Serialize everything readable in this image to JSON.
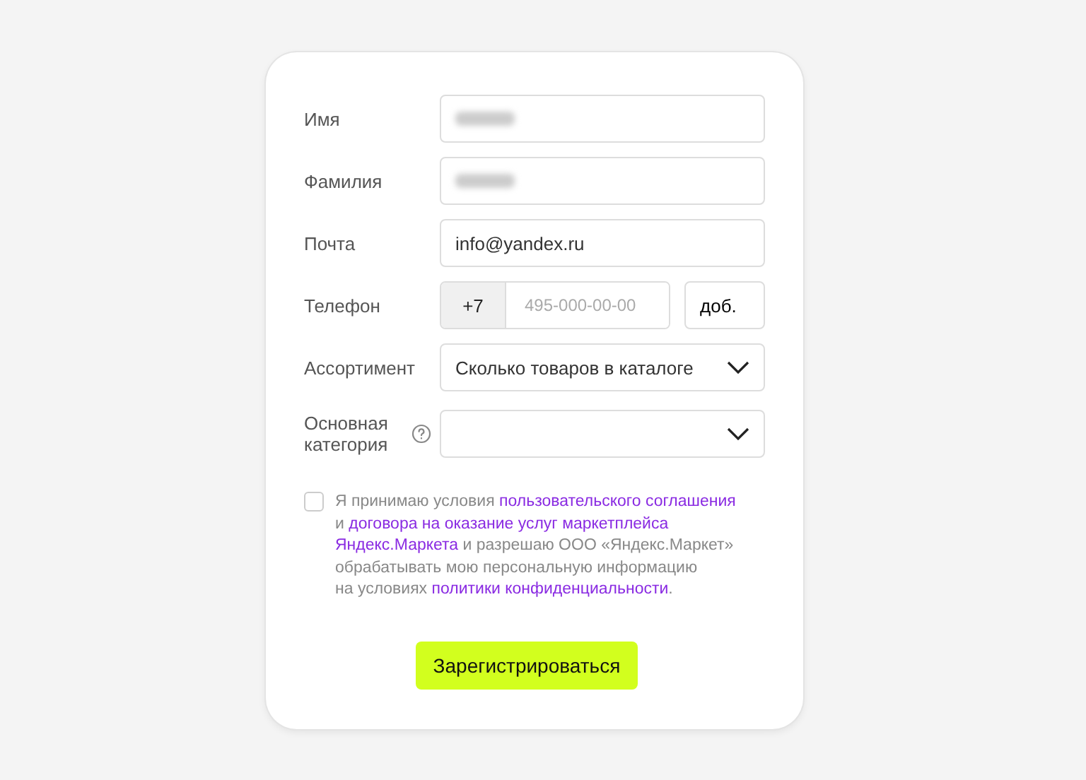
{
  "fields": [
    {
      "kind": "blurred",
      "label": "Имя",
      "help": false
    },
    {
      "kind": "blurred",
      "label": "Фамилия",
      "help": false
    },
    {
      "kind": "text",
      "label": "Почта",
      "value": "info@yandex.ru",
      "help": false
    },
    {
      "kind": "phone",
      "label": "Телефон",
      "prefix": "+7",
      "placeholder": "495-000-00-00",
      "extension": "доб.",
      "help": false
    },
    {
      "kind": "select",
      "label": "Ассортимент",
      "value": "Сколько товаров в каталоге",
      "help": false
    },
    {
      "kind": "select",
      "label": "Основная категория",
      "help": true
    }
  ],
  "consent": {
    "checked": false,
    "lines": [
      [
        {
          "kind": "text",
          "text": "Я принимаю условия "
        },
        {
          "kind": "link",
          "text": "пользовательского соглашения"
        }
      ],
      [
        {
          "kind": "text",
          "text": "и "
        },
        {
          "kind": "link",
          "text": "договора на оказание услуг маркетплейса"
        }
      ],
      [
        {
          "kind": "link",
          "text": "Яндекс.Маркета"
        },
        {
          "kind": "text",
          "text": " и разрешаю ООО «Яндекс.Маркет»"
        }
      ],
      [
        {
          "kind": "text",
          "text": "обрабатывать мою персональную информацию"
        }
      ],
      [
        {
          "kind": "text",
          "text": "на условиях "
        },
        {
          "kind": "link",
          "text": "политики конфиденциальности"
        },
        {
          "kind": "text",
          "text": "."
        }
      ]
    ]
  },
  "submit": "Зарегистрироваться"
}
